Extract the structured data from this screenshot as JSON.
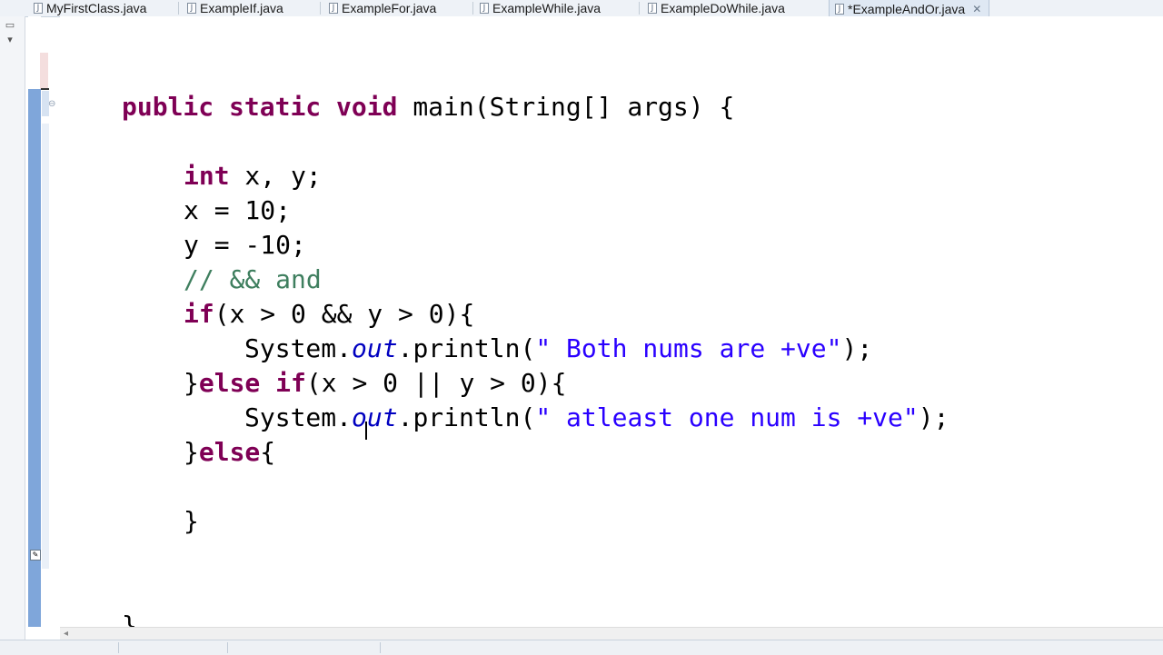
{
  "tabs": [
    {
      "label": "MyFirstClass.java",
      "icon": "java-file-icon"
    },
    {
      "label": "ExampleIf.java",
      "icon": "java-file-icon"
    },
    {
      "label": "ExampleFor.java",
      "icon": "java-file-icon"
    },
    {
      "label": "ExampleWhile.java",
      "icon": "java-file-icon"
    },
    {
      "label": "ExampleDoWhile.java",
      "icon": "java-file-icon"
    },
    {
      "label": "*ExampleAndOr.java",
      "icon": "java-file-icon",
      "active": true
    }
  ],
  "code": {
    "l1": {
      "kw1": "public",
      "kw2": "static",
      "kw3": "void",
      "rest": " main(String[] args) {"
    },
    "l2": {
      "kw": "int",
      "rest": " x, y;"
    },
    "l3": {
      "text": "x = 10;"
    },
    "l4": {
      "text": "y = -10;"
    },
    "l5": {
      "comment": "// && and"
    },
    "l6": {
      "kw": "if",
      "rest": "(x > 0 && y > 0){"
    },
    "l7": {
      "pre": "System.",
      "field": "out",
      "mid": ".println(",
      "str": "\" Both nums are +ve\"",
      "post": ");"
    },
    "l8": {
      "pre": "}",
      "kw1": "else",
      "sp": " ",
      "kw2": "if",
      "rest": "(x > 0 || y > 0){"
    },
    "l9": {
      "pre": "System.",
      "field": "out",
      "mid": ".println(",
      "str": "\" atleast one num is +ve\"",
      "post": ");"
    },
    "l10": {
      "pre": "}",
      "kw": "else",
      "rest": "{"
    },
    "l11": {
      "text": ""
    },
    "l12": {
      "text": "}"
    },
    "l13": {
      "text": "}"
    }
  },
  "colors": {
    "keyword": "#7f0055",
    "string": "#2a00ff",
    "comment": "#3f7f5f",
    "field": "#0000c0",
    "current_line": "#e8f2fe"
  }
}
